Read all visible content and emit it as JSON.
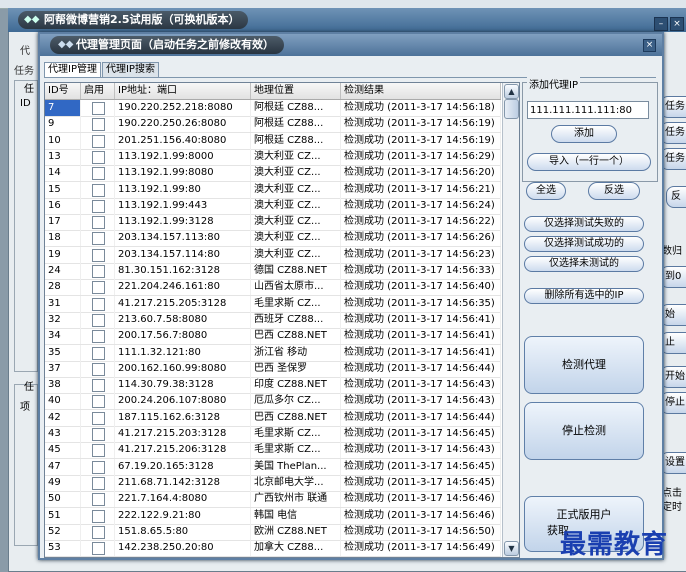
{
  "background_window": {
    "title": "阿帮微博营销2.5试用版（可换机版本）",
    "tabs": [
      "代",
      "任务"
    ],
    "left_labels": [
      "任",
      "ID",
      "任",
      "项"
    ],
    "right_buttons": [
      "任务",
      "任务",
      "任务",
      "反",
      "数归",
      "到0",
      "始",
      "止",
      "开始",
      "停止",
      "设置",
      "点击",
      "定时"
    ]
  },
  "dialog": {
    "title": "代理管理页面（启动任务之前修改有效）",
    "tabs": [
      {
        "label": "代理IP管理",
        "active": true
      },
      {
        "label": "代理IP搜索",
        "active": false
      }
    ],
    "table": {
      "columns": [
        "ID号",
        "启用",
        "IP地址：端口",
        "地理位置",
        "检测结果"
      ],
      "rows": [
        {
          "id": "7",
          "ip": "190.220.252.218:8080",
          "loc": "阿根廷   CZ88...",
          "result": "检测成功 (2011-3-17 14:56:18)"
        },
        {
          "id": "9",
          "ip": "190.220.250.26:8080",
          "loc": "阿根廷   CZ88...",
          "result": "检测成功 (2011-3-17 14:56:19)"
        },
        {
          "id": "10",
          "ip": "201.251.156.40:8080",
          "loc": "阿根廷   CZ88...",
          "result": "检测成功 (2011-3-17 14:56:19)"
        },
        {
          "id": "13",
          "ip": "113.192.1.99:8000",
          "loc": "澳大利亚   CZ...",
          "result": "检测成功 (2011-3-17 14:56:29)"
        },
        {
          "id": "14",
          "ip": "113.192.1.99:8080",
          "loc": "澳大利亚   CZ...",
          "result": "检测成功 (2011-3-17 14:56:20)"
        },
        {
          "id": "15",
          "ip": "113.192.1.99:80",
          "loc": "澳大利亚   CZ...",
          "result": "检测成功 (2011-3-17 14:56:21)"
        },
        {
          "id": "16",
          "ip": "113.192.1.99:443",
          "loc": "澳大利亚   CZ...",
          "result": "检测成功 (2011-3-17 14:56:24)"
        },
        {
          "id": "17",
          "ip": "113.192.1.99:3128",
          "loc": "澳大利亚   CZ...",
          "result": "检测成功 (2011-3-17 14:56:22)"
        },
        {
          "id": "18",
          "ip": "203.134.157.113:80",
          "loc": "澳大利亚   CZ...",
          "result": "检测成功 (2011-3-17 14:56:26)"
        },
        {
          "id": "19",
          "ip": "203.134.157.114:80",
          "loc": "澳大利亚   CZ...",
          "result": "检测成功 (2011-3-17 14:56:23)"
        },
        {
          "id": "24",
          "ip": "81.30.151.162:3128",
          "loc": "德国   CZ88.NET",
          "result": "检测成功 (2011-3-17 14:56:33)"
        },
        {
          "id": "28",
          "ip": "221.204.246.161:80",
          "loc": "山西省太原市...",
          "result": "检测成功 (2011-3-17 14:56:40)"
        },
        {
          "id": "31",
          "ip": "41.217.215.205:3128",
          "loc": "毛里求斯   CZ...",
          "result": "检测成功 (2011-3-17 14:56:35)"
        },
        {
          "id": "32",
          "ip": "213.60.7.58:8080",
          "loc": "西班牙   CZ88...",
          "result": "检测成功 (2011-3-17 14:56:41)"
        },
        {
          "id": "34",
          "ip": "200.17.56.7:8080",
          "loc": "巴西   CZ88.NET",
          "result": "检测成功 (2011-3-17 14:56:41)"
        },
        {
          "id": "35",
          "ip": "111.1.32.121:80",
          "loc": "浙江省 移动",
          "result": "检测成功 (2011-3-17 14:56:41)"
        },
        {
          "id": "37",
          "ip": "200.162.160.99:8080",
          "loc": "巴西 圣保罗",
          "result": "检测成功 (2011-3-17 14:56:44)"
        },
        {
          "id": "38",
          "ip": "114.30.79.38:3128",
          "loc": "印度   CZ88.NET",
          "result": "检测成功 (2011-3-17 14:56:43)"
        },
        {
          "id": "40",
          "ip": "200.24.206.107:8080",
          "loc": "厄瓜多尔   CZ...",
          "result": "检测成功 (2011-3-17 14:56:43)"
        },
        {
          "id": "42",
          "ip": "187.115.162.6:3128",
          "loc": "巴西   CZ88.NET",
          "result": "检测成功 (2011-3-17 14:56:44)"
        },
        {
          "id": "43",
          "ip": "41.217.215.203:3128",
          "loc": "毛里求斯   CZ...",
          "result": "检测成功 (2011-3-17 14:56:45)"
        },
        {
          "id": "45",
          "ip": "41.217.215.206:3128",
          "loc": "毛里求斯   CZ...",
          "result": "检测成功 (2011-3-17 14:56:43)"
        },
        {
          "id": "47",
          "ip": "67.19.20.165:3128",
          "loc": "美国 ThePlan...",
          "result": "检测成功 (2011-3-17 14:56:45)"
        },
        {
          "id": "49",
          "ip": "211.68.71.142:3128",
          "loc": "北京邮电大学...",
          "result": "检测成功 (2011-3-17 14:56:45)"
        },
        {
          "id": "50",
          "ip": "221.7.164.4:8080",
          "loc": "广西钦州市 联通",
          "result": "检测成功 (2011-3-17 14:56:46)"
        },
        {
          "id": "51",
          "ip": "222.122.9.21:80",
          "loc": "韩国 电信",
          "result": "检测成功 (2011-3-17 14:56:46)"
        },
        {
          "id": "52",
          "ip": "151.8.65.5:80",
          "loc": "欧洲   CZ88.NET",
          "result": "检测成功 (2011-3-17 14:56:50)"
        },
        {
          "id": "53",
          "ip": "142.238.250.20:80",
          "loc": "加拿大   CZ88...",
          "result": "检测成功 (2011-3-17 14:56:49)"
        }
      ]
    },
    "add_group": {
      "label": "添加代理IP",
      "ip_value": "111.111.111.111:80",
      "add_button": "添加",
      "import_button": "导入（一行一个）"
    },
    "buttons": {
      "select_all": "全选",
      "invert": "反选",
      "select_failed": "仅选择测试失败的",
      "select_success": "仅选择测试成功的",
      "select_untested": "仅选择未测试的",
      "delete_selected": "删除所有选中的IP",
      "check_proxy": "检测代理",
      "stop_check": "停止检测",
      "official_line1": "正式版用户",
      "official_line2": "获取"
    }
  },
  "watermark": "最需教育",
  "colors": {
    "selection": "#3168c4",
    "title_bar": "#4d7299",
    "watermark": "#1a3fb0"
  }
}
